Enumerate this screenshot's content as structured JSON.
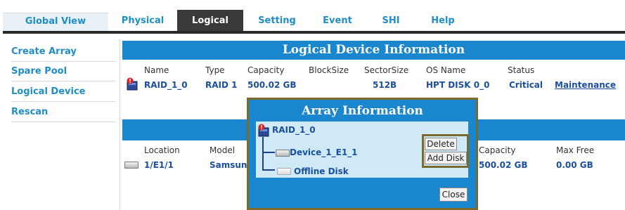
{
  "nav": {
    "tabs": [
      "Global View",
      "Physical",
      "Logical",
      "Setting",
      "Event",
      "SHI",
      "Help"
    ],
    "active": "Logical"
  },
  "sidebar": {
    "items": [
      "Create Array",
      "Spare Pool",
      "Logical Device",
      "Rescan"
    ]
  },
  "logical": {
    "title": "Logical Device Information",
    "headers": [
      "Name",
      "Type",
      "Capacity",
      "BlockSize",
      "SectorSize",
      "OS Name",
      "Status"
    ],
    "row": {
      "name": "RAID_1_0",
      "type": "RAID 1",
      "capacity": "500.02 GB",
      "blocksize": "",
      "sectorsize": "512B",
      "os_name": "HPT DISK 0_0",
      "status": "Critical",
      "action": "Maintenance"
    },
    "status_color": "#1b4fa0"
  },
  "physical": {
    "headers": [
      "Location",
      "Model",
      "Capacity",
      "Max Free"
    ],
    "row": {
      "location": "1/E1/1",
      "model": "Samsun",
      "capacity": "500.02 GB",
      "max_free": "0.00 GB"
    }
  },
  "dialog": {
    "title": "Array Information",
    "array_name": "RAID_1_0",
    "devices": [
      "Device_1_E1_1",
      "Offline Disk"
    ],
    "buttons": {
      "delete": "Delete",
      "add_disk": "Add Disk",
      "close": "Close"
    }
  },
  "colors": {
    "accent": "#1a86ce",
    "link": "#1f8dc8",
    "dialog_border": "#7b6a2a"
  }
}
